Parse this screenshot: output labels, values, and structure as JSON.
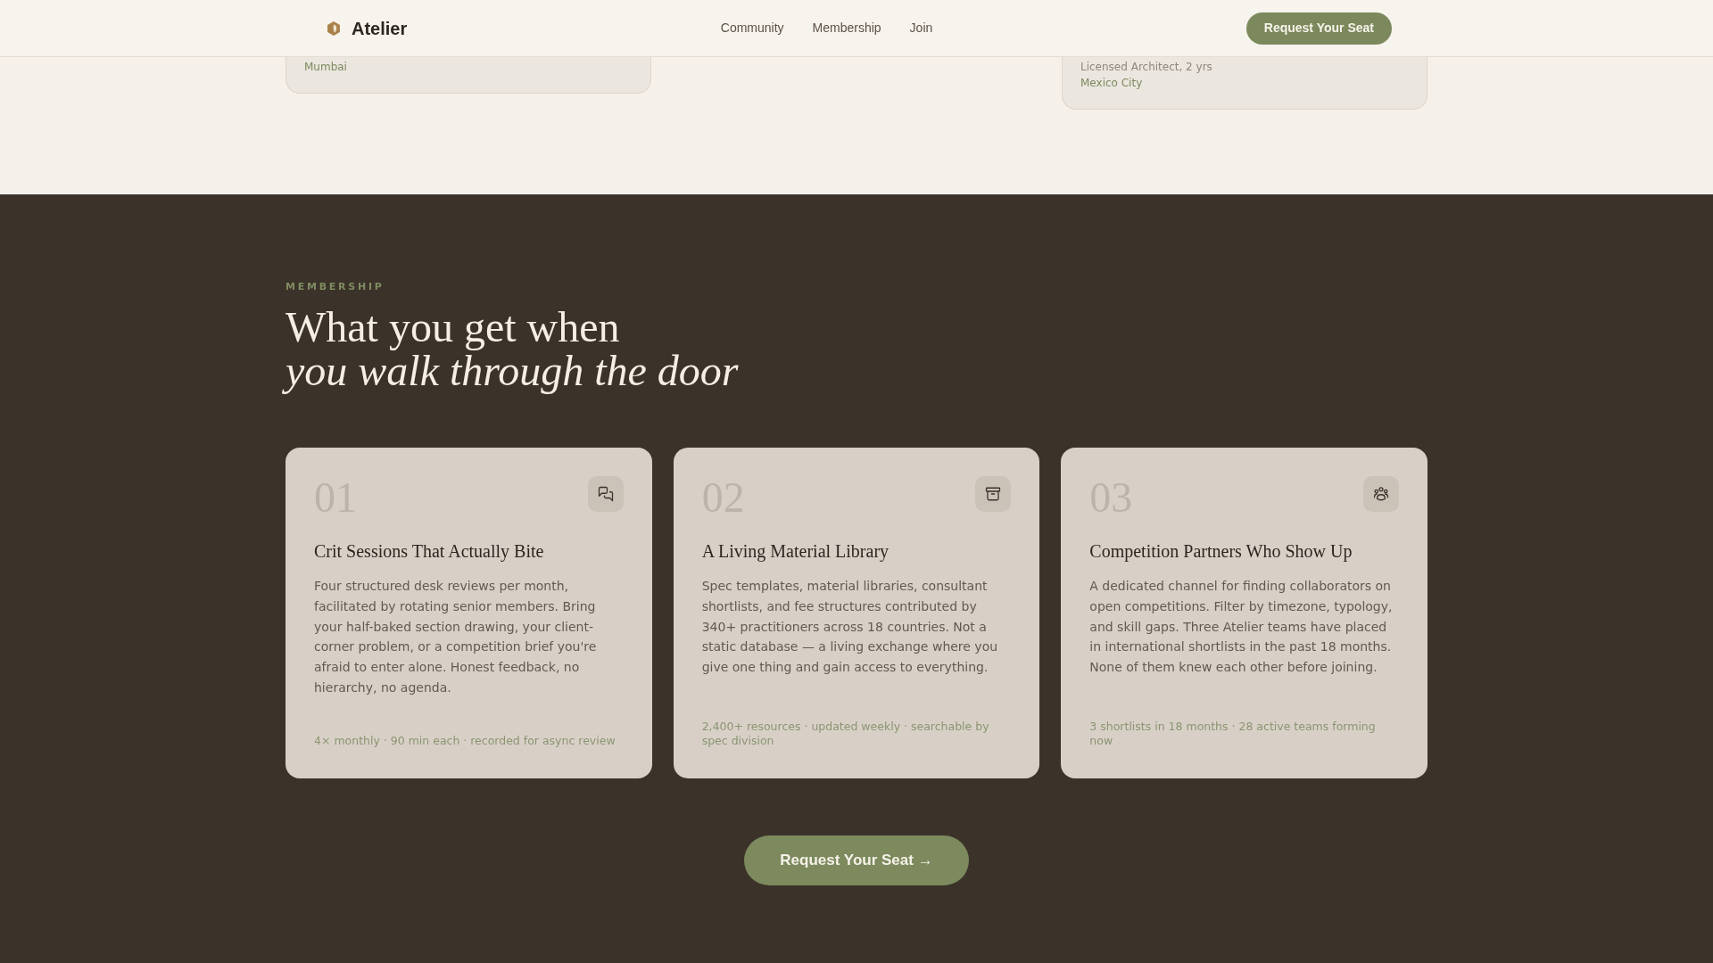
{
  "header": {
    "brand": "Atelier",
    "nav": [
      "Community",
      "Membership",
      "Join"
    ],
    "cta": "Request Your Seat"
  },
  "previous_cards": [
    {
      "location": "Mumbai"
    },
    {
      "role": "Licensed Architect, 2 yrs",
      "location": "Mexico City"
    }
  ],
  "membership": {
    "eyebrow": "MEMBERSHIP",
    "heading": "What you get when *you walk through the door*",
    "cards": [
      {
        "number": "01",
        "title": "Crit Sessions That Actually Bite",
        "description": "Four structured desk reviews per month, facilitated by rotating senior members. Bring your half-baked section drawing, your client-corner problem, or a competition brief you're afraid to enter alone. Honest feedback, no hierarchy, no agenda.",
        "meta": "4× monthly · 90 min each · recorded for async review"
      },
      {
        "number": "02",
        "title": "A Living Material Library",
        "description": "Spec templates, material libraries, consultant shortlists, and fee structures contributed by 340+ practitioners across 18 countries. Not a static database — a living exchange where you give one thing and gain access to everything.",
        "meta": "2,400+ resources · updated weekly · searchable by spec division"
      },
      {
        "number": "03",
        "title": "Competition Partners Who Show Up",
        "description": "A dedicated channel for finding collaborators on open competitions. Filter by timezone, typology, and skill gaps. Three Atelier teams have placed in international shortlists in the past 18 months. None of them knew each other before joining.",
        "meta": "3 shortlists in 18 months · 28 active teams forming now"
      }
    ],
    "cta": "Request Your Seat →"
  }
}
